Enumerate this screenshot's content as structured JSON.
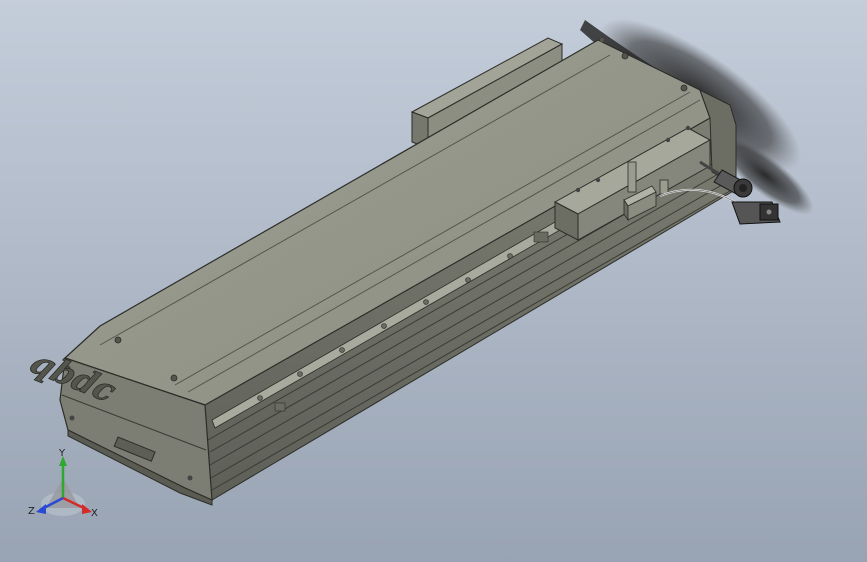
{
  "scene": {
    "background_top": "#c2cbd8",
    "background_bottom": "#9aa5b5",
    "body_color": "#8a8c80",
    "top_color": "#96988c",
    "side_color": "#6e7066",
    "edge_color": "#2c2d28",
    "motor_color": "#333333"
  },
  "logo": {
    "text": "qbdc"
  },
  "triad": {
    "y_label": "Y",
    "x_label": "X",
    "z_label": "Z",
    "y_color": "#2ea82e",
    "x_color": "#d42a2a",
    "z_color": "#2a4ad4"
  }
}
